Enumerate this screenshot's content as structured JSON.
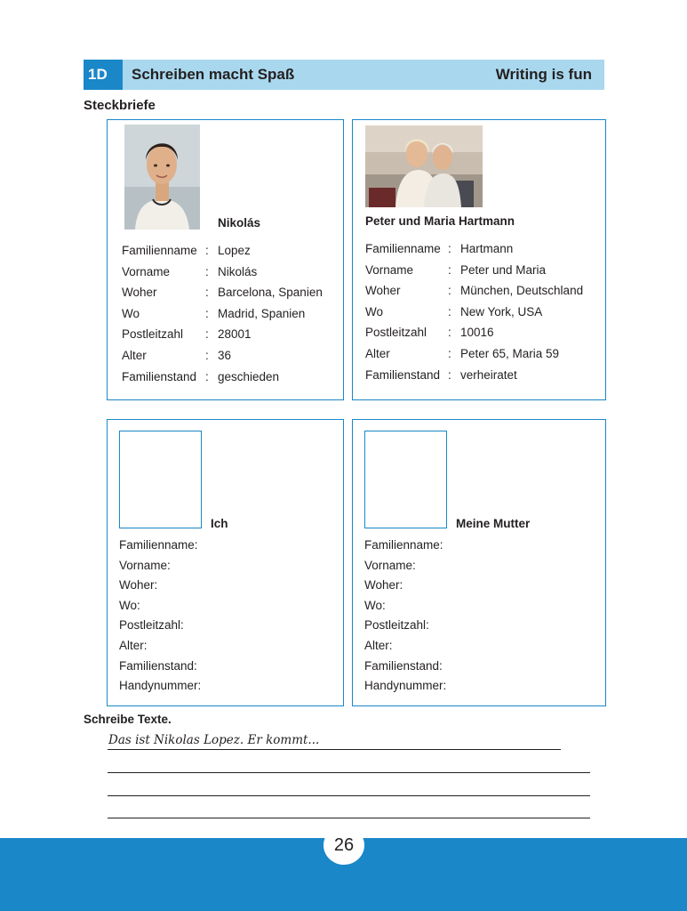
{
  "header": {
    "number": "1D",
    "title": "Schreiben macht Spaß",
    "title_en": "Writing is fun"
  },
  "section_title": "Steckbriefe",
  "cards": [
    {
      "name": "Nikolás",
      "fields": [
        {
          "label": "Familienname",
          "value": "Lopez"
        },
        {
          "label": "Vorname",
          "value": "Nikolás"
        },
        {
          "label": "Woher",
          "value": "Barcelona, Spanien"
        },
        {
          "label": "Wo",
          "value": "Madrid, Spanien"
        },
        {
          "label": "Postleitzahl",
          "value": "28001"
        },
        {
          "label": "Alter",
          "value": "36"
        },
        {
          "label": "Familienstand",
          "value": "geschieden"
        }
      ]
    },
    {
      "name": "Peter und Maria Hartmann",
      "fields": [
        {
          "label": "Familienname",
          "value": "Hartmann"
        },
        {
          "label": "Vorname",
          "value": "Peter und Maria"
        },
        {
          "label": "Woher",
          "value": "München, Deutschland"
        },
        {
          "label": "Wo",
          "value": "New York, USA"
        },
        {
          "label": "Postleitzahl",
          "value": "10016"
        },
        {
          "label": "Alter",
          "value": "Peter 65, Maria 59"
        },
        {
          "label": "Familienstand",
          "value": "verheiratet"
        }
      ]
    },
    {
      "name": "Ich",
      "blank_fields": [
        "Familienname:",
        "Vorname:",
        "Woher:",
        "Wo:",
        "Postleitzahl:",
        "Alter:",
        "Familienstand:",
        "Handynummer:"
      ]
    },
    {
      "name": "Meine Mutter",
      "blank_fields": [
        "Familienname:",
        "Vorname:",
        "Woher:",
        "Wo:",
        "Postleitzahl:",
        "Alter:",
        "Familienstand:",
        "Handynummer:"
      ]
    }
  ],
  "colon": ":",
  "write": {
    "title": "Schreibe Texte.",
    "example": "Das ist Nikolas Lopez. Er kommt..."
  },
  "page_number": "26",
  "colors": {
    "accent": "#1a87c9",
    "header_band": "#a9d8ee"
  }
}
